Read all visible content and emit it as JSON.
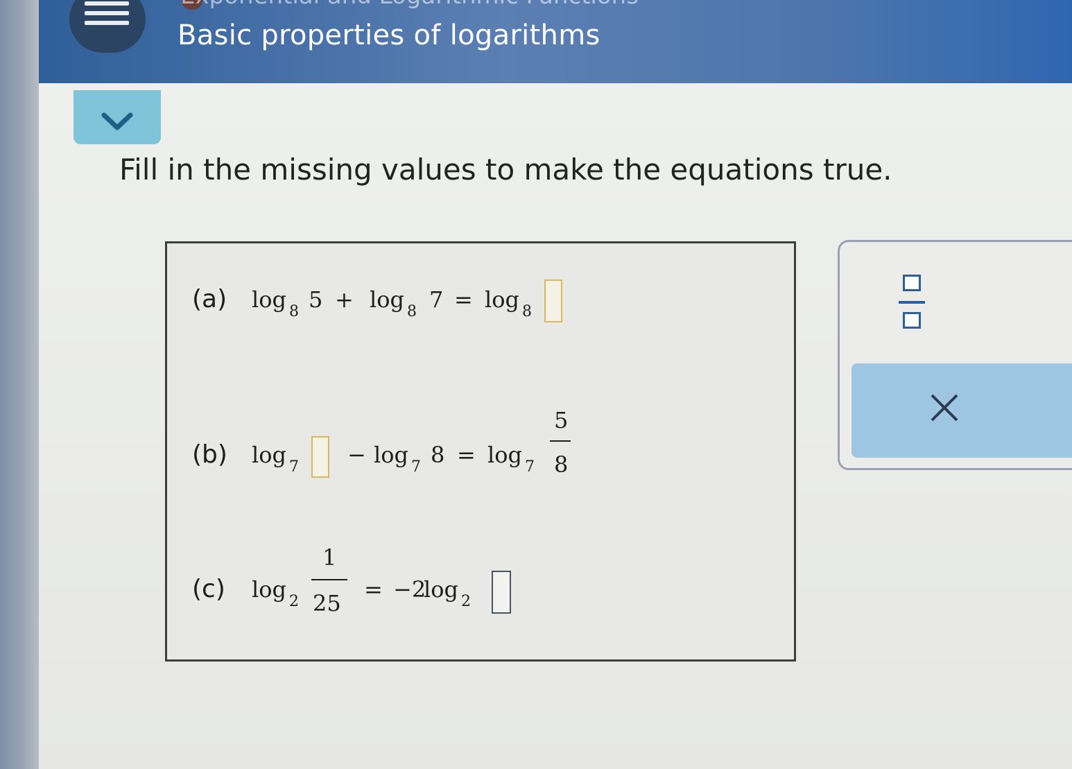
{
  "header": {
    "title": "Basic properties of logarithms",
    "top_text": "Exponential and Logarithmic Functions",
    "menu_icon": "hamburger-icon"
  },
  "collapse_icon": "chevron-down-icon",
  "instruction": "Fill in the missing values to make the equations true.",
  "equations": {
    "a": {
      "label": "(a)",
      "log": "log",
      "base": "8",
      "term1": "5",
      "plus": "+",
      "term2": "7",
      "equals": "="
    },
    "b": {
      "label": "(b)",
      "log": "log",
      "base": "7",
      "minus": "−",
      "term2": "8",
      "equals": "=",
      "frac_num": "5",
      "frac_den": "8"
    },
    "c": {
      "label": "(c)",
      "log": "log",
      "base": "2",
      "frac_num": "1",
      "frac_den": "25",
      "equals": "=",
      "rhs_coef": "−2",
      "rhs_log": "log"
    }
  },
  "tools": {
    "fraction_icon": "fraction-icon",
    "clear_icon": "close-icon",
    "clear_symbol": "×"
  },
  "colors": {
    "header_blue": "#2f5f99",
    "collapse_teal": "#7fc4d9",
    "answer_box_border": "#d9b85a",
    "clear_button": "#9ec5e2"
  }
}
